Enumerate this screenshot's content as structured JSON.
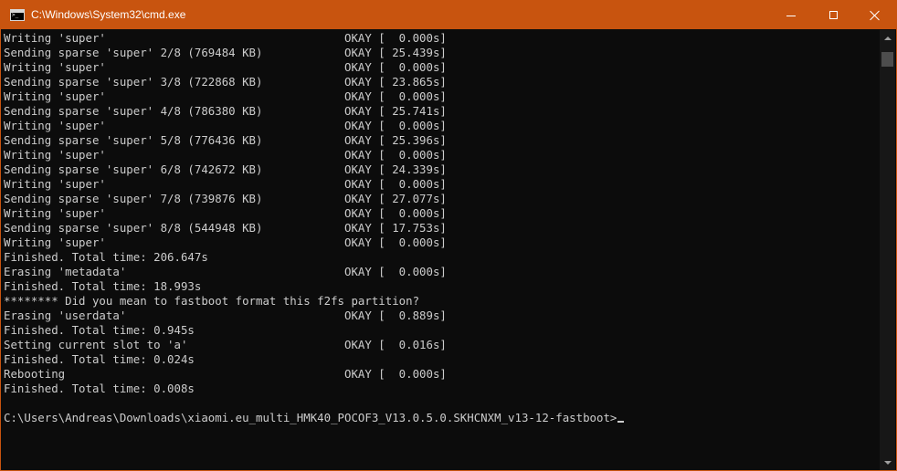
{
  "window": {
    "title": "C:\\Windows\\System32\\cmd.exe",
    "controls": {
      "minimize": "minimize",
      "maximize": "maximize",
      "close": "close"
    }
  },
  "colors": {
    "titlebar_accent": "#c8540f",
    "console_background": "#0c0c0c",
    "console_text": "#cccccc"
  },
  "console": {
    "lines": [
      "Writing 'super'                                   OKAY [  0.000s]",
      "Sending sparse 'super' 2/8 (769484 KB)            OKAY [ 25.439s]",
      "Writing 'super'                                   OKAY [  0.000s]",
      "Sending sparse 'super' 3/8 (722868 KB)            OKAY [ 23.865s]",
      "Writing 'super'                                   OKAY [  0.000s]",
      "Sending sparse 'super' 4/8 (786380 KB)            OKAY [ 25.741s]",
      "Writing 'super'                                   OKAY [  0.000s]",
      "Sending sparse 'super' 5/8 (776436 KB)            OKAY [ 25.396s]",
      "Writing 'super'                                   OKAY [  0.000s]",
      "Sending sparse 'super' 6/8 (742672 KB)            OKAY [ 24.339s]",
      "Writing 'super'                                   OKAY [  0.000s]",
      "Sending sparse 'super' 7/8 (739876 KB)            OKAY [ 27.077s]",
      "Writing 'super'                                   OKAY [  0.000s]",
      "Sending sparse 'super' 8/8 (544948 KB)            OKAY [ 17.753s]",
      "Writing 'super'                                   OKAY [  0.000s]",
      "Finished. Total time: 206.647s",
      "Erasing 'metadata'                                OKAY [  0.000s]",
      "Finished. Total time: 18.993s",
      "******** Did you mean to fastboot format this f2fs partition?",
      "Erasing 'userdata'                                OKAY [  0.889s]",
      "Finished. Total time: 0.945s",
      "Setting current slot to 'a'                       OKAY [  0.016s]",
      "Finished. Total time: 0.024s",
      "Rebooting                                         OKAY [  0.000s]",
      "Finished. Total time: 0.008s",
      "",
      "C:\\Users\\Andreas\\Downloads\\xiaomi.eu_multi_HMK40_POCOF3_V13.0.5.0.SKHCNXM_v13-12-fastboot>"
    ]
  }
}
